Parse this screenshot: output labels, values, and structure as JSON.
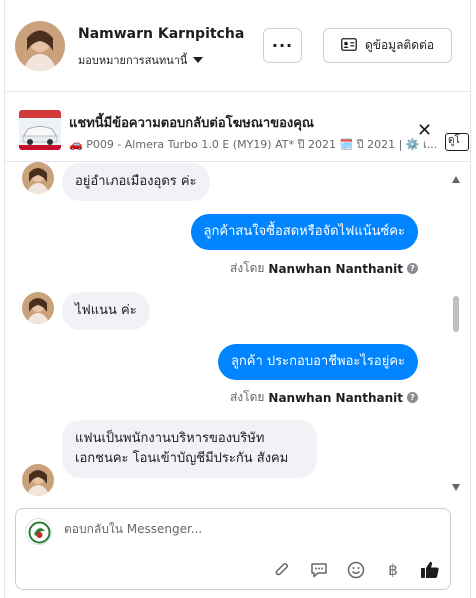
{
  "header": {
    "contact_name": "Namwarn Karnpitcha",
    "assign_label": "มอบหมายการสนทนานี้",
    "more_label": "···",
    "view_contact_label": "ดูข้อมูลติดต่อ"
  },
  "ad": {
    "title": "แชทนี้มีข้อความตอบกลับต่อโฆษณาของคุณ",
    "subtitle": "🚗 P009 - Almera Turbo 1.0 E (MY19) AT* ปี 2021 🗓️ ปี 2021 | ⚙️ เ...",
    "tooltip_tag": "ดูโ"
  },
  "messages": [
    {
      "dir": "in",
      "text": "อยู่อำเภอเมืองอุดร ค่ะ"
    },
    {
      "dir": "out",
      "text": "ลูกค้าสนใจซื้อสดหรือจัดไฟแน้นซ์คะ"
    },
    {
      "dir": "in",
      "text": "ไฟแนน ค่ะ"
    },
    {
      "dir": "out",
      "text": "ลูกค้า ประกอบอาชีพอะไรอยู่คะ"
    },
    {
      "dir": "in",
      "text": "แฟนเป็นพนักงานบริหารของบริษัท เอกชนคะ โอนเข้าบัญชีมีประกัน สังคม"
    }
  ],
  "sent_by": {
    "prefix": "ส่งโดย",
    "name": "Nanwhan Nanthanit",
    "help": "?"
  },
  "composer": {
    "placeholder": "ตอบกลับใน Messenger...",
    "tools": [
      "paperclip-icon",
      "chat-bubble-icon",
      "emoji-icon",
      "baht-icon",
      "thumbs-up-icon"
    ]
  },
  "colors": {
    "accent": "#0084ff",
    "incoming_bg": "#f0f2f5",
    "muted": "#65676b"
  }
}
